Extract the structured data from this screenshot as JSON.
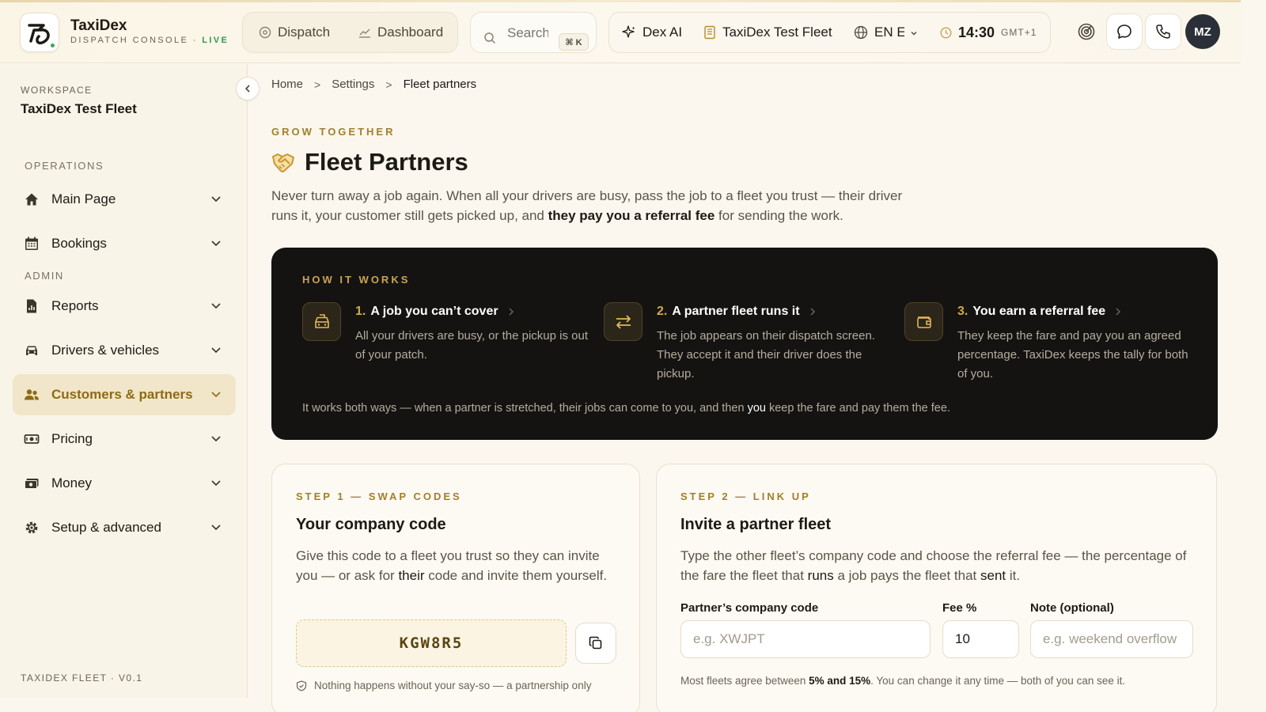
{
  "brand": {
    "name": "TaxiDex",
    "sub": "DISPATCH CONSOLE ·",
    "live": "LIVE"
  },
  "nav": {
    "dispatch": "Dispatch",
    "dashboard": "Dashboard"
  },
  "search": {
    "placeholder": "Search",
    "shortcut": "⌘ K"
  },
  "context": {
    "ai": "Dex AI",
    "fleet": "TaxiDex Test Fleet",
    "lang": "EN En",
    "time": "14:30",
    "tz": "GMT+1"
  },
  "user": {
    "initials": "MZ"
  },
  "sidebar": {
    "workspace_label": "WORKSPACE",
    "workspace_name": "TaxiDex Test Fleet",
    "operations_label": "OPERATIONS",
    "admin_label": "ADMIN",
    "items": [
      {
        "label": "Main Page"
      },
      {
        "label": "Bookings"
      },
      {
        "label": "Reports"
      },
      {
        "label": "Drivers & vehicles"
      },
      {
        "label": "Customers & partners"
      },
      {
        "label": "Pricing"
      },
      {
        "label": "Money"
      },
      {
        "label": "Setup & advanced"
      }
    ],
    "footer": "TAXIDEX FLEET · V0.1"
  },
  "breadcrumb": {
    "home": "Home",
    "settings": "Settings",
    "current": "Fleet partners"
  },
  "page": {
    "eyebrow": "GROW TOGETHER",
    "title": "Fleet Partners",
    "intro_1": "Never turn away a job again. When all your drivers are busy, pass the job to a fleet you trust — their driver runs it, your customer still gets picked up, and ",
    "intro_bold": "they pay you a referral fee",
    "intro_2": " for sending the work."
  },
  "how": {
    "label": "HOW IT WORKS",
    "steps": [
      {
        "num": "1.",
        "title": "A job you can’t cover",
        "desc": "All your drivers are busy, or the pickup is out of your patch."
      },
      {
        "num": "2.",
        "title": "A partner fleet runs it",
        "desc": "The job appears on their dispatch screen. They accept it and their driver does the pickup."
      },
      {
        "num": "3.",
        "title": "You earn a referral fee",
        "desc": "They keep the fare and pay you an agreed percentage. TaxiDex keeps the tally for both of you."
      }
    ],
    "foot_1": "It works both ways — when a partner is stretched, their jobs can come to you, and then ",
    "foot_bold": "you",
    "foot_2": " keep the fare and pay them the fee."
  },
  "card1": {
    "eyebrow": "STEP 1 — SWAP CODES",
    "title": "Your company code",
    "desc_1": "Give this code to a fleet you trust so they can invite you — or ask for ",
    "desc_bold": "their",
    "desc_2": " code and invite them yourself.",
    "code": "KGW8R5",
    "note": "Nothing happens without your say-so — a partnership only"
  },
  "card2": {
    "eyebrow": "STEP 2 — LINK UP",
    "title": "Invite a partner fleet",
    "desc_1": "Type the other fleet’s company code and choose the referral fee — the percentage of the fare the fleet that ",
    "desc_b1": "runs",
    "desc_2": " a job pays the fleet that ",
    "desc_b2": "sent",
    "desc_3": " it.",
    "code_label": "Partner’s company code",
    "code_placeholder": "e.g. XWJPT",
    "fee_label": "Fee %",
    "fee_value": "10",
    "note_label": "Note (optional)",
    "note_placeholder": "e.g. weekend overflow",
    "hint_1": "Most fleets agree between ",
    "hint_bold": "5% and 15%",
    "hint_2": ". You can change it any time — both of you can see it."
  }
}
